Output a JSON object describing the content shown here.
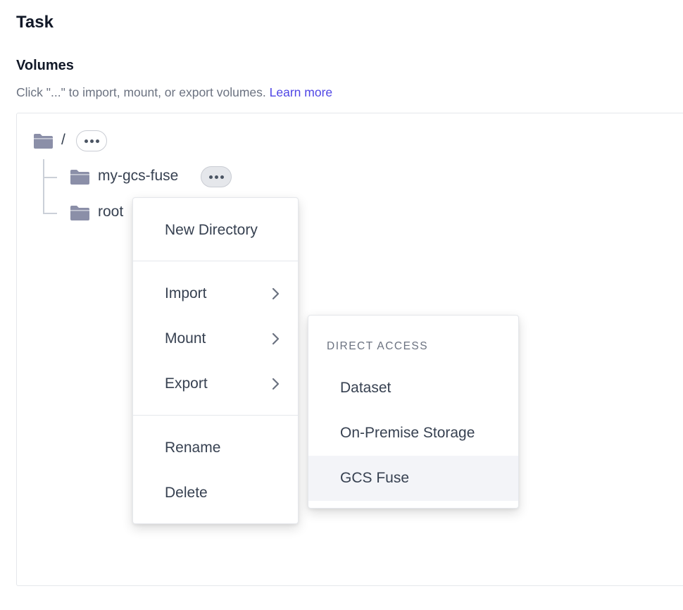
{
  "page": {
    "title": "Task"
  },
  "volumes": {
    "title": "Volumes",
    "help_text": "Click \"...\" to import, mount, or export volumes.",
    "learn_more": "Learn more"
  },
  "tree": {
    "root_label": "/",
    "children": [
      {
        "label": "my-gcs-fuse"
      },
      {
        "label": "root"
      }
    ]
  },
  "context_menu": {
    "items": [
      {
        "label": "New Directory"
      },
      {
        "label": "Import"
      },
      {
        "label": "Mount"
      },
      {
        "label": "Export"
      },
      {
        "label": "Rename"
      },
      {
        "label": "Delete"
      }
    ]
  },
  "submenu": {
    "heading": "DIRECT ACCESS",
    "items": [
      {
        "label": "Dataset"
      },
      {
        "label": "On-Premise Storage"
      },
      {
        "label": "GCS Fuse"
      }
    ]
  },
  "colors": {
    "accent": "#4f46e5",
    "folder": "#8b8fa8",
    "highlight": "#f3f4f8"
  }
}
